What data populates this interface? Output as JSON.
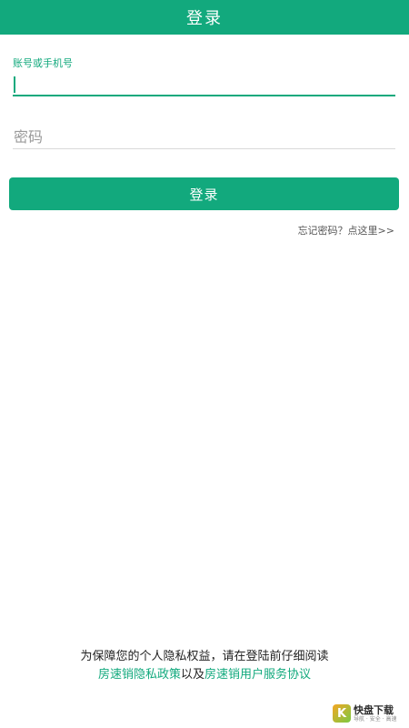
{
  "header": {
    "title": "登录"
  },
  "form": {
    "account": {
      "label": "账号或手机号",
      "value": "",
      "placeholder": ""
    },
    "password": {
      "value": "",
      "placeholder": "密码"
    },
    "login_button": "登录",
    "forgot_link": "忘记密码？点这里>>"
  },
  "footer": {
    "line1": "为保障您的个人隐私权益，请在登陆前仔细阅读",
    "privacy_policy_link": "房速销隐私政策",
    "connector": "以及",
    "service_agreement_link": "房速销用户服务协议"
  },
  "watermark": {
    "logo_char": "K",
    "title": "快盘下载",
    "subtitle": "导航 · 安全 · 高速"
  },
  "colors": {
    "accent": "#12a97d",
    "background": "#ffffff"
  }
}
